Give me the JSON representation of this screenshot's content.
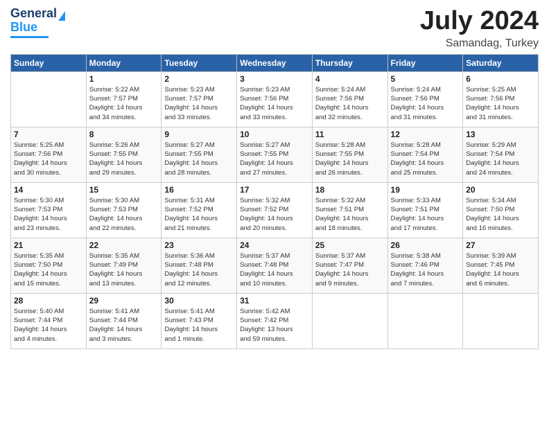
{
  "header": {
    "logo_line1": "General",
    "logo_line2": "Blue",
    "month": "July 2024",
    "location": "Samandag, Turkey"
  },
  "weekdays": [
    "Sunday",
    "Monday",
    "Tuesday",
    "Wednesday",
    "Thursday",
    "Friday",
    "Saturday"
  ],
  "weeks": [
    [
      {
        "day": "",
        "info": ""
      },
      {
        "day": "1",
        "info": "Sunrise: 5:22 AM\nSunset: 7:57 PM\nDaylight: 14 hours\nand 34 minutes."
      },
      {
        "day": "2",
        "info": "Sunrise: 5:23 AM\nSunset: 7:57 PM\nDaylight: 14 hours\nand 33 minutes."
      },
      {
        "day": "3",
        "info": "Sunrise: 5:23 AM\nSunset: 7:56 PM\nDaylight: 14 hours\nand 33 minutes."
      },
      {
        "day": "4",
        "info": "Sunrise: 5:24 AM\nSunset: 7:56 PM\nDaylight: 14 hours\nand 32 minutes."
      },
      {
        "day": "5",
        "info": "Sunrise: 5:24 AM\nSunset: 7:56 PM\nDaylight: 14 hours\nand 31 minutes."
      },
      {
        "day": "6",
        "info": "Sunrise: 5:25 AM\nSunset: 7:56 PM\nDaylight: 14 hours\nand 31 minutes."
      }
    ],
    [
      {
        "day": "7",
        "info": "Sunrise: 5:25 AM\nSunset: 7:56 PM\nDaylight: 14 hours\nand 30 minutes."
      },
      {
        "day": "8",
        "info": "Sunrise: 5:26 AM\nSunset: 7:55 PM\nDaylight: 14 hours\nand 29 minutes."
      },
      {
        "day": "9",
        "info": "Sunrise: 5:27 AM\nSunset: 7:55 PM\nDaylight: 14 hours\nand 28 minutes."
      },
      {
        "day": "10",
        "info": "Sunrise: 5:27 AM\nSunset: 7:55 PM\nDaylight: 14 hours\nand 27 minutes."
      },
      {
        "day": "11",
        "info": "Sunrise: 5:28 AM\nSunset: 7:55 PM\nDaylight: 14 hours\nand 26 minutes."
      },
      {
        "day": "12",
        "info": "Sunrise: 5:28 AM\nSunset: 7:54 PM\nDaylight: 14 hours\nand 25 minutes."
      },
      {
        "day": "13",
        "info": "Sunrise: 5:29 AM\nSunset: 7:54 PM\nDaylight: 14 hours\nand 24 minutes."
      }
    ],
    [
      {
        "day": "14",
        "info": "Sunrise: 5:30 AM\nSunset: 7:53 PM\nDaylight: 14 hours\nand 23 minutes."
      },
      {
        "day": "15",
        "info": "Sunrise: 5:30 AM\nSunset: 7:53 PM\nDaylight: 14 hours\nand 22 minutes."
      },
      {
        "day": "16",
        "info": "Sunrise: 5:31 AM\nSunset: 7:52 PM\nDaylight: 14 hours\nand 21 minutes."
      },
      {
        "day": "17",
        "info": "Sunrise: 5:32 AM\nSunset: 7:52 PM\nDaylight: 14 hours\nand 20 minutes."
      },
      {
        "day": "18",
        "info": "Sunrise: 5:32 AM\nSunset: 7:51 PM\nDaylight: 14 hours\nand 18 minutes."
      },
      {
        "day": "19",
        "info": "Sunrise: 5:33 AM\nSunset: 7:51 PM\nDaylight: 14 hours\nand 17 minutes."
      },
      {
        "day": "20",
        "info": "Sunrise: 5:34 AM\nSunset: 7:50 PM\nDaylight: 14 hours\nand 16 minutes."
      }
    ],
    [
      {
        "day": "21",
        "info": "Sunrise: 5:35 AM\nSunset: 7:50 PM\nDaylight: 14 hours\nand 15 minutes."
      },
      {
        "day": "22",
        "info": "Sunrise: 5:35 AM\nSunset: 7:49 PM\nDaylight: 14 hours\nand 13 minutes."
      },
      {
        "day": "23",
        "info": "Sunrise: 5:36 AM\nSunset: 7:48 PM\nDaylight: 14 hours\nand 12 minutes."
      },
      {
        "day": "24",
        "info": "Sunrise: 5:37 AM\nSunset: 7:48 PM\nDaylight: 14 hours\nand 10 minutes."
      },
      {
        "day": "25",
        "info": "Sunrise: 5:37 AM\nSunset: 7:47 PM\nDaylight: 14 hours\nand 9 minutes."
      },
      {
        "day": "26",
        "info": "Sunrise: 5:38 AM\nSunset: 7:46 PM\nDaylight: 14 hours\nand 7 minutes."
      },
      {
        "day": "27",
        "info": "Sunrise: 5:39 AM\nSunset: 7:45 PM\nDaylight: 14 hours\nand 6 minutes."
      }
    ],
    [
      {
        "day": "28",
        "info": "Sunrise: 5:40 AM\nSunset: 7:44 PM\nDaylight: 14 hours\nand 4 minutes."
      },
      {
        "day": "29",
        "info": "Sunrise: 5:41 AM\nSunset: 7:44 PM\nDaylight: 14 hours\nand 3 minutes."
      },
      {
        "day": "30",
        "info": "Sunrise: 5:41 AM\nSunset: 7:43 PM\nDaylight: 14 hours\nand 1 minute."
      },
      {
        "day": "31",
        "info": "Sunrise: 5:42 AM\nSunset: 7:42 PM\nDaylight: 13 hours\nand 59 minutes."
      },
      {
        "day": "",
        "info": ""
      },
      {
        "day": "",
        "info": ""
      },
      {
        "day": "",
        "info": ""
      }
    ]
  ]
}
